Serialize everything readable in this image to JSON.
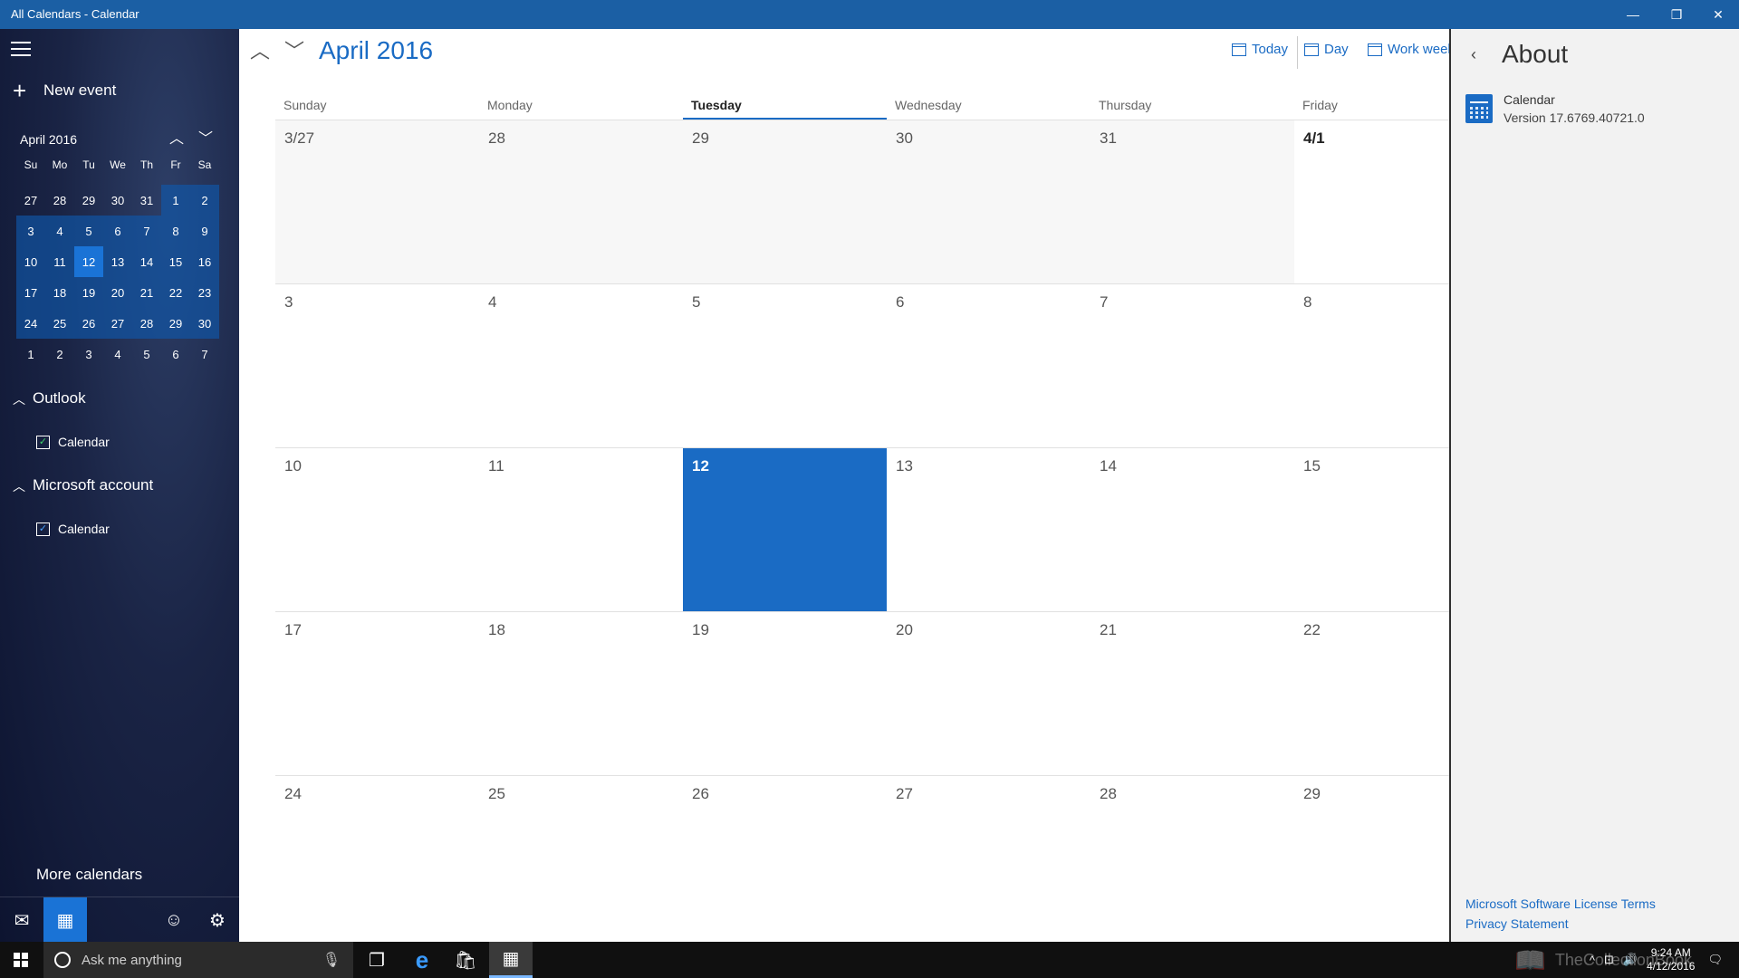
{
  "window": {
    "title": "All Calendars - Calendar",
    "minimize_glyph": "—",
    "restore_glyph": "❐",
    "close_glyph": "✕"
  },
  "sidebar": {
    "new_event_label": "New event",
    "mini_calendar": {
      "title": "April 2016",
      "up_glyph": "︿",
      "down_glyph": "﹀",
      "dow": [
        "Su",
        "Mo",
        "Tu",
        "We",
        "Th",
        "Fr",
        "Sa"
      ],
      "rows": [
        [
          "27",
          "28",
          "29",
          "30",
          "31",
          "1",
          "2"
        ],
        [
          "3",
          "4",
          "5",
          "6",
          "7",
          "8",
          "9"
        ],
        [
          "10",
          "11",
          "12",
          "13",
          "14",
          "15",
          "16"
        ],
        [
          "17",
          "18",
          "19",
          "20",
          "21",
          "22",
          "23"
        ],
        [
          "24",
          "25",
          "26",
          "27",
          "28",
          "29",
          "30"
        ],
        [
          "1",
          "2",
          "3",
          "4",
          "5",
          "6",
          "7"
        ]
      ]
    },
    "groups": [
      {
        "name": "Outlook",
        "chevron": "﹀",
        "calendar": "Calendar",
        "checked": "✓"
      },
      {
        "name": "Microsoft account",
        "chevron": "﹀",
        "calendar": "Calendar",
        "checked": "✓"
      }
    ],
    "more_calendars": "More calendars",
    "bottom_icons": [
      "mail-icon",
      "calendar-icon",
      "feedback-smiley-icon",
      "settings-gear-icon"
    ],
    "bottom_glyphs": [
      "✉",
      "▦",
      "☺",
      "⚙"
    ]
  },
  "main": {
    "month_title": "April 2016",
    "nav_up": "︿",
    "nav_down": "﹀",
    "views": {
      "today": "Today",
      "day": "Day",
      "workweek": "Work week"
    },
    "weekdays": [
      "Sunday",
      "Monday",
      "Tuesday",
      "Wednesday",
      "Thursday",
      "Friday"
    ],
    "weeks": [
      [
        "3/27",
        "28",
        "29",
        "30",
        "31",
        "4/1"
      ],
      [
        "3",
        "4",
        "5",
        "6",
        "7",
        "8"
      ],
      [
        "10",
        "11",
        "12",
        "13",
        "14",
        "15"
      ],
      [
        "17",
        "18",
        "19",
        "20",
        "21",
        "22"
      ],
      [
        "24",
        "25",
        "26",
        "27",
        "28",
        "29"
      ]
    ]
  },
  "about": {
    "back_glyph": "‹",
    "title": "About",
    "app_name": "Calendar",
    "version": "Version 17.6769.40721.0",
    "license_link": "Microsoft Software License Terms",
    "privacy_link": "Privacy Statement"
  },
  "taskbar": {
    "search_placeholder": "Ask me anything",
    "mic_glyph": "🎙",
    "task_view_glyph": "❐",
    "edge_glyph": "e",
    "store_glyph": "🛍",
    "calendar_glyph": "▦",
    "tray_glyphs": [
      "^",
      "⊡",
      "🔊"
    ],
    "time": "9:24 AM",
    "date": "4/12/2016",
    "notification_glyph": "🗨",
    "watermark": "TheCollectionBook"
  }
}
